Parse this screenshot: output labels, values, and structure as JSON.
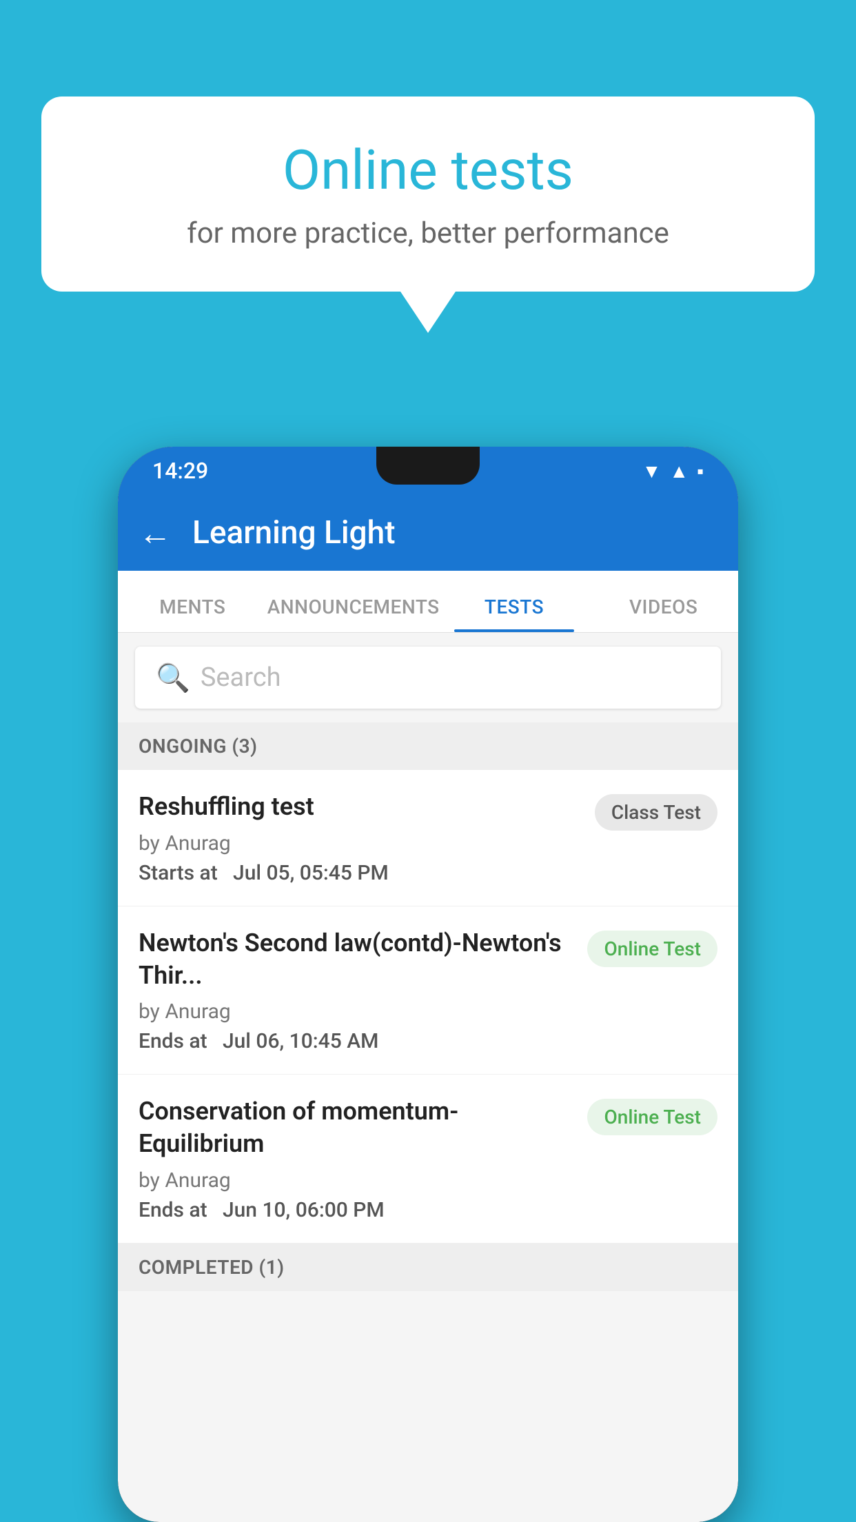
{
  "background": {
    "color": "#29b6d8"
  },
  "speech_bubble": {
    "title": "Online tests",
    "subtitle": "for more practice, better performance"
  },
  "phone": {
    "status_bar": {
      "time": "14:29",
      "icons": [
        "wifi",
        "signal",
        "battery"
      ]
    },
    "app_bar": {
      "title": "Learning Light",
      "back_label": "←"
    },
    "tabs": [
      {
        "label": "MENTS",
        "active": false
      },
      {
        "label": "ANNOUNCEMENTS",
        "active": false
      },
      {
        "label": "TESTS",
        "active": true
      },
      {
        "label": "VIDEOS",
        "active": false
      }
    ],
    "search": {
      "placeholder": "Search"
    },
    "ongoing_section": {
      "header": "ONGOING (3)",
      "tests": [
        {
          "name": "Reshuffling test",
          "author": "by Anurag",
          "time_label": "Starts at",
          "time_value": "Jul 05, 05:45 PM",
          "badge": "Class Test",
          "badge_type": "class"
        },
        {
          "name": "Newton's Second law(contd)-Newton's Thir...",
          "author": "by Anurag",
          "time_label": "Ends at",
          "time_value": "Jul 06, 10:45 AM",
          "badge": "Online Test",
          "badge_type": "online"
        },
        {
          "name": "Conservation of momentum-Equilibrium",
          "author": "by Anurag",
          "time_label": "Ends at",
          "time_value": "Jun 10, 06:00 PM",
          "badge": "Online Test",
          "badge_type": "online"
        }
      ]
    },
    "completed_section": {
      "header": "COMPLETED (1)"
    }
  }
}
